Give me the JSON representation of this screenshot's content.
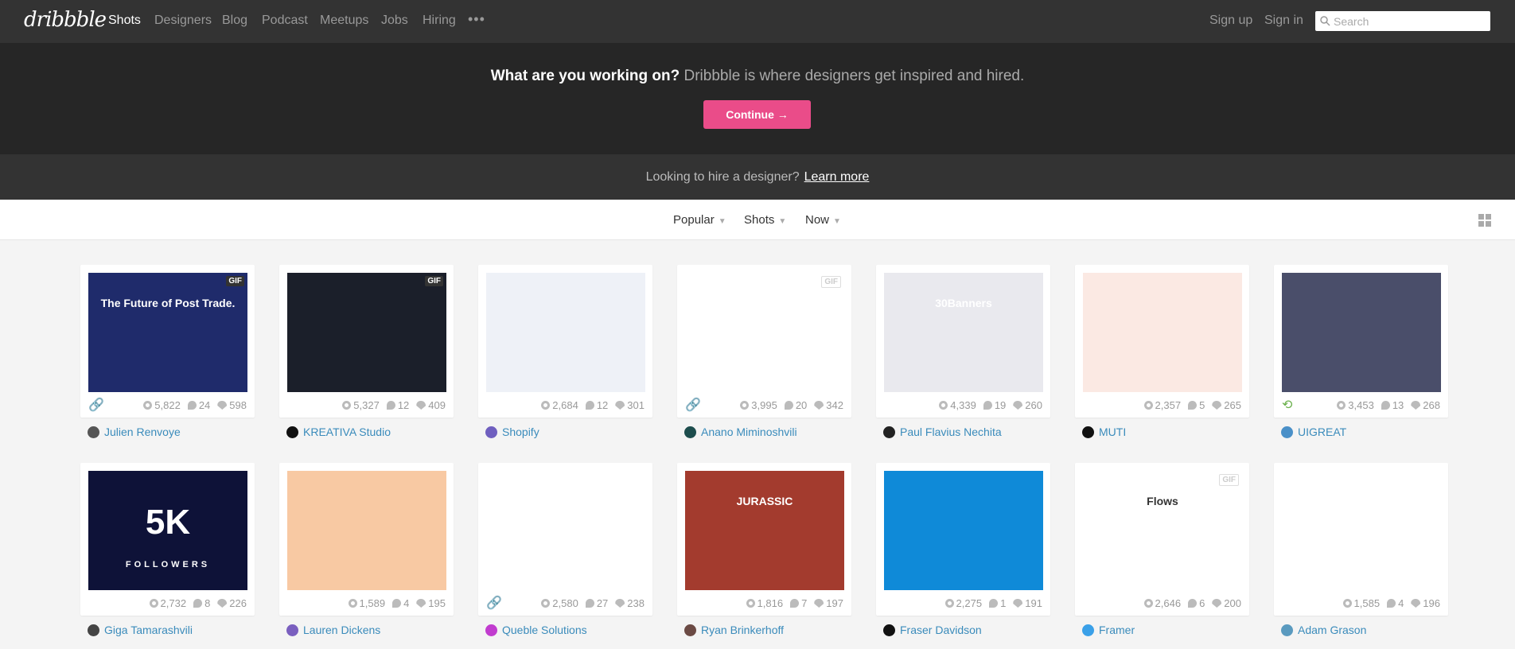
{
  "nav": {
    "logo": "dribbble",
    "items": [
      "Shots",
      "Designers",
      "Blog",
      "Podcast",
      "Meetups",
      "Jobs",
      "Hiring"
    ],
    "more": "•••",
    "signup": "Sign up",
    "signin": "Sign in",
    "search_placeholder": "Search"
  },
  "hero": {
    "bold": "What are you working on?",
    "text": " Dribbble is where designers get inspired and hired.",
    "button": "Continue →",
    "button_color": "#ea4c89"
  },
  "hire": {
    "text": "Looking to hire a designer?",
    "link": "Learn more"
  },
  "filters": {
    "sort": "Popular",
    "type": "Shots",
    "time": "Now"
  },
  "shots": [
    {
      "author": "Julien Renvoye",
      "views": "5,822",
      "comments": "24",
      "likes": "598",
      "gif": true,
      "link": true,
      "bg": "#1f2b6b",
      "title": "The Future of Post Trade.",
      "av": "#555"
    },
    {
      "author": "KREATIVA Studio",
      "views": "5,327",
      "comments": "12",
      "likes": "409",
      "gif": true,
      "bg": "#1b1f2a",
      "av": "#111"
    },
    {
      "author": "Shopify",
      "views": "2,684",
      "comments": "12",
      "likes": "301",
      "bg": "#eef1f7",
      "av": "#6f5fbf"
    },
    {
      "author": "Anano Miminoshvili",
      "views": "3,995",
      "comments": "20",
      "likes": "342",
      "gif": true,
      "gif_light": true,
      "link": true,
      "bg": "#ffffff",
      "av": "#1d4d4d"
    },
    {
      "author": "Paul Flavius Nechita",
      "views": "4,339",
      "comments": "19",
      "likes": "260",
      "bg": "#e9e9ee",
      "title": "30Banners",
      "av": "#222"
    },
    {
      "author": "MUTI",
      "views": "2,357",
      "comments": "5",
      "likes": "265",
      "bg": "#fbe9e3",
      "av": "#111"
    },
    {
      "author": "UIGREAT",
      "views": "3,453",
      "comments": "13",
      "likes": "268",
      "bg": "#4a4e6a",
      "badge": true,
      "av": "#4a90c8"
    },
    {
      "author": "Giga Tamarashvili",
      "views": "2,732",
      "comments": "8",
      "likes": "226",
      "bg": "#0e1238",
      "title": "5K",
      "subtitle": "FOLLOWERS",
      "av": "#444"
    },
    {
      "author": "Lauren Dickens",
      "views": "1,589",
      "comments": "4",
      "likes": "195",
      "bg": "#f8c9a3",
      "av": "#7a5fbf"
    },
    {
      "author": "Queble Solutions",
      "views": "2,580",
      "comments": "27",
      "likes": "238",
      "link": true,
      "bg": "#ffffff",
      "av": "#c13ccf"
    },
    {
      "author": "Ryan Brinkerhoff",
      "views": "1,816",
      "comments": "7",
      "likes": "197",
      "bg": "#a33b2e",
      "title": "JURASSIC",
      "av": "#6b4a44"
    },
    {
      "author": "Fraser Davidson",
      "views": "2,275",
      "comments": "1",
      "likes": "191",
      "bg": "#0f8ad8",
      "av": "#111"
    },
    {
      "author": "Framer",
      "views": "2,646",
      "comments": "6",
      "likes": "200",
      "gif": true,
      "gif_light": true,
      "bg": "#ffffff",
      "title": "Flows",
      "av": "#3aa0e8"
    },
    {
      "author": "Adam Grason",
      "views": "1,585",
      "comments": "4",
      "likes": "196",
      "bg": "#ffffff",
      "av": "#5a9abf"
    }
  ]
}
